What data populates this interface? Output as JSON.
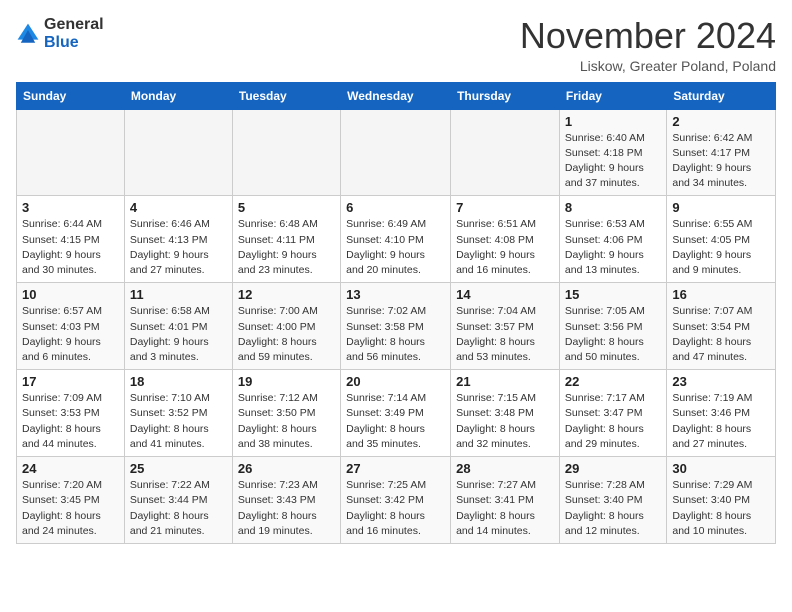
{
  "logo": {
    "text_general": "General",
    "text_blue": "Blue"
  },
  "title": "November 2024",
  "location": "Liskow, Greater Poland, Poland",
  "days_of_week": [
    "Sunday",
    "Monday",
    "Tuesday",
    "Wednesday",
    "Thursday",
    "Friday",
    "Saturday"
  ],
  "weeks": [
    [
      {
        "day": "",
        "info": ""
      },
      {
        "day": "",
        "info": ""
      },
      {
        "day": "",
        "info": ""
      },
      {
        "day": "",
        "info": ""
      },
      {
        "day": "",
        "info": ""
      },
      {
        "day": "1",
        "info": "Sunrise: 6:40 AM\nSunset: 4:18 PM\nDaylight: 9 hours\nand 37 minutes."
      },
      {
        "day": "2",
        "info": "Sunrise: 6:42 AM\nSunset: 4:17 PM\nDaylight: 9 hours\nand 34 minutes."
      }
    ],
    [
      {
        "day": "3",
        "info": "Sunrise: 6:44 AM\nSunset: 4:15 PM\nDaylight: 9 hours\nand 30 minutes."
      },
      {
        "day": "4",
        "info": "Sunrise: 6:46 AM\nSunset: 4:13 PM\nDaylight: 9 hours\nand 27 minutes."
      },
      {
        "day": "5",
        "info": "Sunrise: 6:48 AM\nSunset: 4:11 PM\nDaylight: 9 hours\nand 23 minutes."
      },
      {
        "day": "6",
        "info": "Sunrise: 6:49 AM\nSunset: 4:10 PM\nDaylight: 9 hours\nand 20 minutes."
      },
      {
        "day": "7",
        "info": "Sunrise: 6:51 AM\nSunset: 4:08 PM\nDaylight: 9 hours\nand 16 minutes."
      },
      {
        "day": "8",
        "info": "Sunrise: 6:53 AM\nSunset: 4:06 PM\nDaylight: 9 hours\nand 13 minutes."
      },
      {
        "day": "9",
        "info": "Sunrise: 6:55 AM\nSunset: 4:05 PM\nDaylight: 9 hours\nand 9 minutes."
      }
    ],
    [
      {
        "day": "10",
        "info": "Sunrise: 6:57 AM\nSunset: 4:03 PM\nDaylight: 9 hours\nand 6 minutes."
      },
      {
        "day": "11",
        "info": "Sunrise: 6:58 AM\nSunset: 4:01 PM\nDaylight: 9 hours\nand 3 minutes."
      },
      {
        "day": "12",
        "info": "Sunrise: 7:00 AM\nSunset: 4:00 PM\nDaylight: 8 hours\nand 59 minutes."
      },
      {
        "day": "13",
        "info": "Sunrise: 7:02 AM\nSunset: 3:58 PM\nDaylight: 8 hours\nand 56 minutes."
      },
      {
        "day": "14",
        "info": "Sunrise: 7:04 AM\nSunset: 3:57 PM\nDaylight: 8 hours\nand 53 minutes."
      },
      {
        "day": "15",
        "info": "Sunrise: 7:05 AM\nSunset: 3:56 PM\nDaylight: 8 hours\nand 50 minutes."
      },
      {
        "day": "16",
        "info": "Sunrise: 7:07 AM\nSunset: 3:54 PM\nDaylight: 8 hours\nand 47 minutes."
      }
    ],
    [
      {
        "day": "17",
        "info": "Sunrise: 7:09 AM\nSunset: 3:53 PM\nDaylight: 8 hours\nand 44 minutes."
      },
      {
        "day": "18",
        "info": "Sunrise: 7:10 AM\nSunset: 3:52 PM\nDaylight: 8 hours\nand 41 minutes."
      },
      {
        "day": "19",
        "info": "Sunrise: 7:12 AM\nSunset: 3:50 PM\nDaylight: 8 hours\nand 38 minutes."
      },
      {
        "day": "20",
        "info": "Sunrise: 7:14 AM\nSunset: 3:49 PM\nDaylight: 8 hours\nand 35 minutes."
      },
      {
        "day": "21",
        "info": "Sunrise: 7:15 AM\nSunset: 3:48 PM\nDaylight: 8 hours\nand 32 minutes."
      },
      {
        "day": "22",
        "info": "Sunrise: 7:17 AM\nSunset: 3:47 PM\nDaylight: 8 hours\nand 29 minutes."
      },
      {
        "day": "23",
        "info": "Sunrise: 7:19 AM\nSunset: 3:46 PM\nDaylight: 8 hours\nand 27 minutes."
      }
    ],
    [
      {
        "day": "24",
        "info": "Sunrise: 7:20 AM\nSunset: 3:45 PM\nDaylight: 8 hours\nand 24 minutes."
      },
      {
        "day": "25",
        "info": "Sunrise: 7:22 AM\nSunset: 3:44 PM\nDaylight: 8 hours\nand 21 minutes."
      },
      {
        "day": "26",
        "info": "Sunrise: 7:23 AM\nSunset: 3:43 PM\nDaylight: 8 hours\nand 19 minutes."
      },
      {
        "day": "27",
        "info": "Sunrise: 7:25 AM\nSunset: 3:42 PM\nDaylight: 8 hours\nand 16 minutes."
      },
      {
        "day": "28",
        "info": "Sunrise: 7:27 AM\nSunset: 3:41 PM\nDaylight: 8 hours\nand 14 minutes."
      },
      {
        "day": "29",
        "info": "Sunrise: 7:28 AM\nSunset: 3:40 PM\nDaylight: 8 hours\nand 12 minutes."
      },
      {
        "day": "30",
        "info": "Sunrise: 7:29 AM\nSunset: 3:40 PM\nDaylight: 8 hours\nand 10 minutes."
      }
    ]
  ]
}
